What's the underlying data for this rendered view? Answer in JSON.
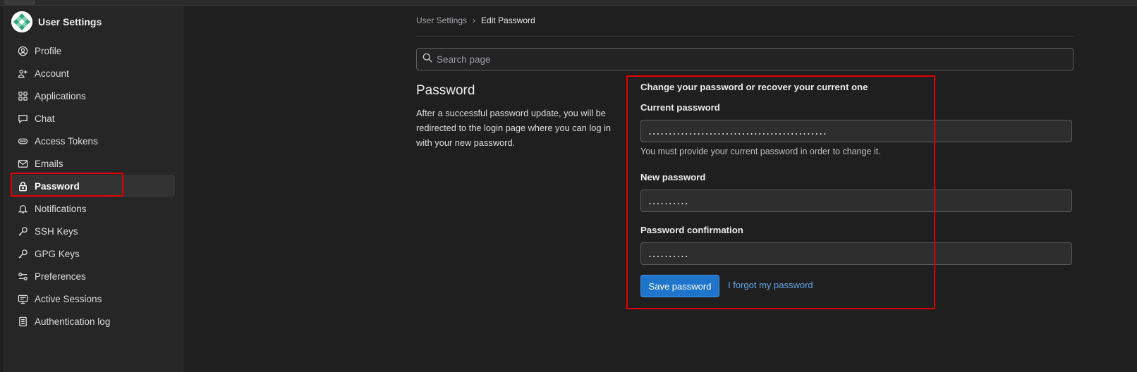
{
  "sidebar": {
    "title": "User Settings",
    "items": [
      {
        "label": "Profile",
        "icon": "profile-icon"
      },
      {
        "label": "Account",
        "icon": "account-icon"
      },
      {
        "label": "Applications",
        "icon": "applications-icon"
      },
      {
        "label": "Chat",
        "icon": "chat-icon"
      },
      {
        "label": "Access Tokens",
        "icon": "token-icon"
      },
      {
        "label": "Emails",
        "icon": "email-icon"
      },
      {
        "label": "Password",
        "icon": "lock-icon",
        "active": true
      },
      {
        "label": "Notifications",
        "icon": "bell-icon"
      },
      {
        "label": "SSH Keys",
        "icon": "key-icon"
      },
      {
        "label": "GPG Keys",
        "icon": "key-icon"
      },
      {
        "label": "Preferences",
        "icon": "preferences-icon"
      },
      {
        "label": "Active Sessions",
        "icon": "monitor-icon"
      },
      {
        "label": "Authentication log",
        "icon": "log-icon"
      }
    ]
  },
  "breadcrumb": {
    "parent": "User Settings",
    "separator": "›",
    "current": "Edit Password"
  },
  "search": {
    "placeholder": "Search page"
  },
  "section": {
    "title": "Password",
    "description": "After a successful password update, you will be redirected to the login page where you can log in with your new password."
  },
  "form": {
    "heading": "Change your password or recover your current one",
    "current_label": "Current password",
    "current_value": "............................................",
    "current_help": "You must provide your current password in order to change it.",
    "new_label": "New password",
    "new_value": "..........",
    "confirm_label": "Password confirmation",
    "confirm_value": "..........",
    "save_label": "Save password",
    "forgot_label": "I forgot my password"
  },
  "colors": {
    "background": "#1f1f1f",
    "sidebar": "#262626",
    "primary_button": "#1f75cb",
    "link": "#63a6e9",
    "highlight": "#e00000"
  }
}
